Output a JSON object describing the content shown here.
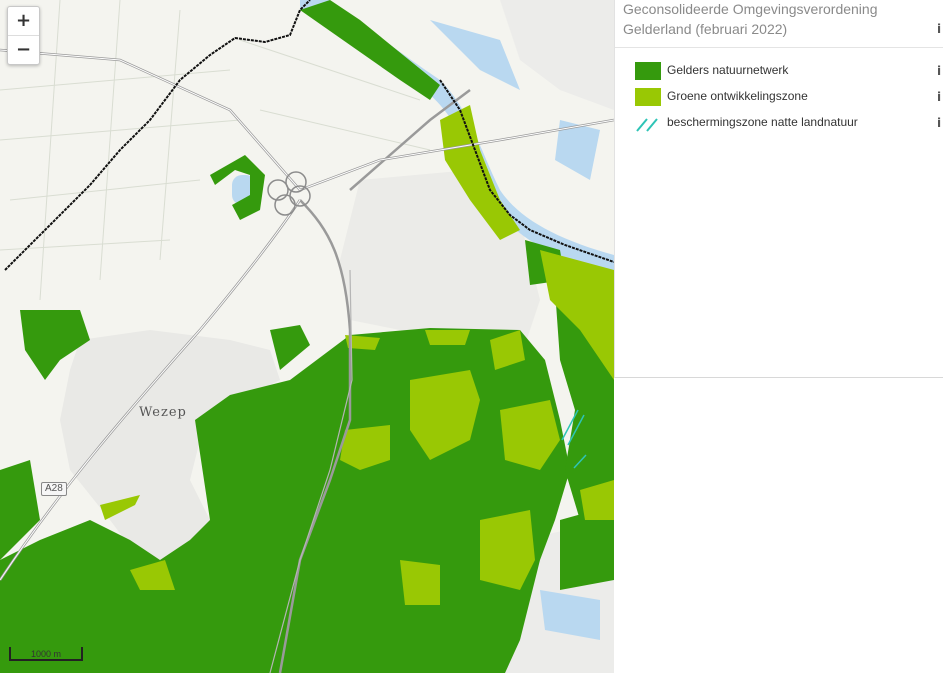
{
  "map": {
    "zoom_in_label": "+",
    "zoom_out_label": "−",
    "scale_label": "1000 m",
    "place_label": "Wezep",
    "road_label": "A28"
  },
  "panel": {
    "title": "Geconsolideerde Omgevingsverordening Gelderland (februari 2022)",
    "info_glyph": "i",
    "legend": [
      {
        "label": "Gelders natuurnetwerk",
        "color": "#359a0d",
        "style": "fill"
      },
      {
        "label": "Groene ontwikkelingszone",
        "color": "#99c804",
        "style": "fill"
      },
      {
        "label": "beschermingszone natte landnatuur",
        "color": "#2ec4b6",
        "style": "hatch"
      }
    ]
  },
  "colors": {
    "natuurnetwerk": "#359a0d",
    "ontwikkelingszone": "#99c804",
    "beschermingszone": "#2ec4b6",
    "water": "#b9d8f0",
    "road": "#8c8c8c"
  }
}
